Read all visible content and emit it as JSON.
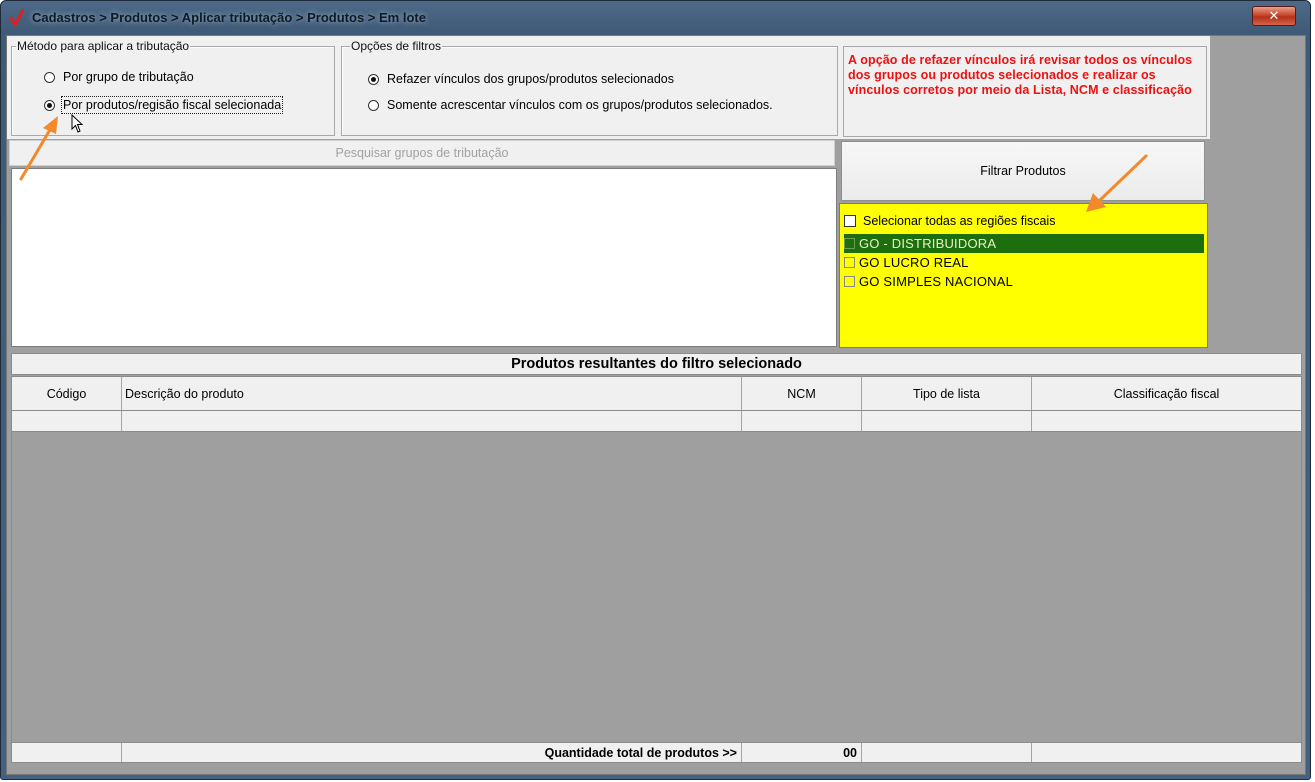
{
  "window": {
    "title": "Cadastros > Produtos > Aplicar tributação > Produtos > Em lote",
    "close_label": "✕"
  },
  "method_group": {
    "legend": "Método para aplicar a tributação",
    "options": [
      {
        "label": "Por grupo de tributação",
        "selected": false
      },
      {
        "label": "Por produtos/regisão fiscal selecionada",
        "selected": true
      }
    ]
  },
  "filter_options_group": {
    "legend": "Opções de filtros",
    "options": [
      {
        "label": "Refazer vínculos dos grupos/produtos selecionados",
        "selected": true
      },
      {
        "label": "Somente acrescentar vínculos com os grupos/produtos selecionados.",
        "selected": false
      }
    ]
  },
  "info_message": "A opção de refazer vínculos irá revisar todos os vínculos dos grupos ou produtos selecionados e realizar os vínculos corretos por meio da Lista, NCM e classificação fiscal de",
  "search": {
    "label": "Pesquisar grupos de tributação"
  },
  "filter_button": {
    "label": "Filtrar Produtos"
  },
  "regions": {
    "select_all_label": "Selecionar todas as regiões fiscais",
    "items": [
      {
        "label": "GO - DISTRIBUIDORA",
        "highlighted": true
      },
      {
        "label": "GO LUCRO REAL",
        "highlighted": false
      },
      {
        "label": "GO SIMPLES NACIONAL",
        "highlighted": false
      }
    ],
    "panel_color": "#ffff00"
  },
  "results": {
    "title": "Produtos resultantes do filtro selecionado",
    "columns": [
      "Código",
      "Descrição do produto",
      "NCM",
      "Tipo de lista",
      "Classificação fiscal"
    ],
    "rows": [],
    "footer_label": "Quantidade total de produtos >>",
    "footer_total": "00"
  },
  "colors": {
    "annotation_arrow": "#f28a2b",
    "info_text": "#ee1010",
    "selected_region": "#1c6e0e"
  },
  "icons": {
    "title": "red-check-icon",
    "pointer": "mouse-pointer-icon",
    "annotation": "orange-arrow-icon"
  }
}
